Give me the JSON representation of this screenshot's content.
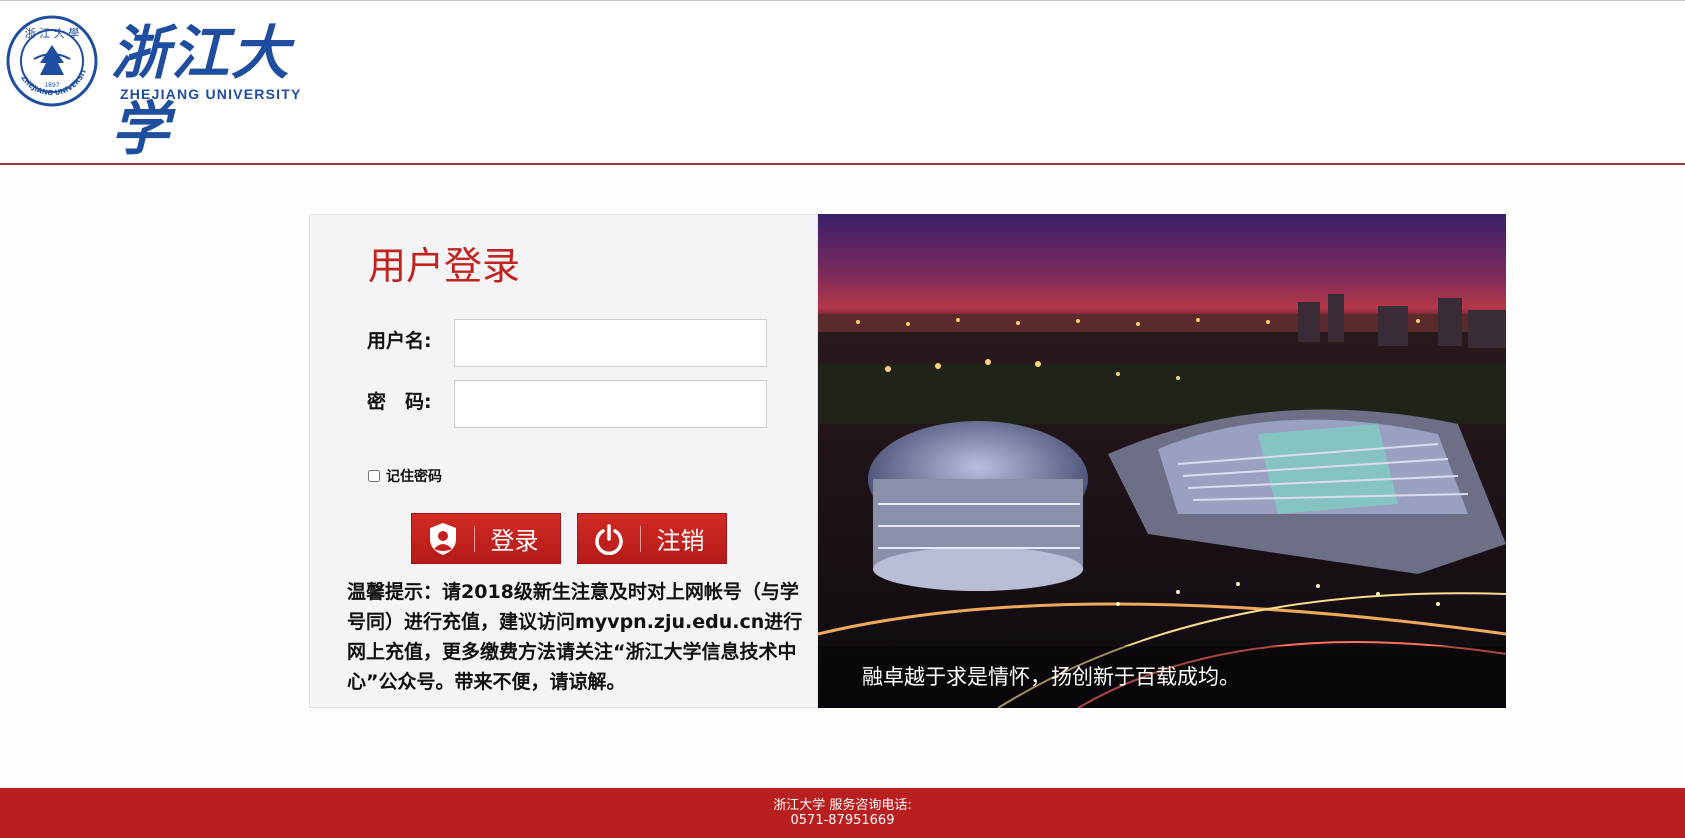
{
  "header": {
    "brand_cn": "浙江大学",
    "brand_en": "ZHEJIANG UNIVERSITY",
    "seal_year": "1897",
    "seal_text": "ZHEJIANG UNIVERSITY"
  },
  "login": {
    "title": "用户登录",
    "username_label": "用户名:",
    "username_value": "",
    "password_label": "密　码:",
    "password_value": "",
    "remember_label": "记住密码",
    "remember_checked": false,
    "login_button": "登录",
    "logout_button": "注销",
    "notice": "温馨提示：请2018级新生注意及时对上网帐号（与学号同）进行充值，建议访问myvpn.zju.edu.cn进行网上充值，更多缴费方法请关注“浙江大学信息技术中心”公众号。带来不便，请谅解。"
  },
  "banner": {
    "caption": "融卓越于求是情怀，扬创新于百载成均。"
  },
  "footer": {
    "line1": "浙江大学 服务咨询电话:",
    "line2": "0571-87951669"
  },
  "colors": {
    "brand_blue": "#1f4ea0",
    "accent_red": "#c0241f",
    "footer_red": "#b91f1f"
  }
}
